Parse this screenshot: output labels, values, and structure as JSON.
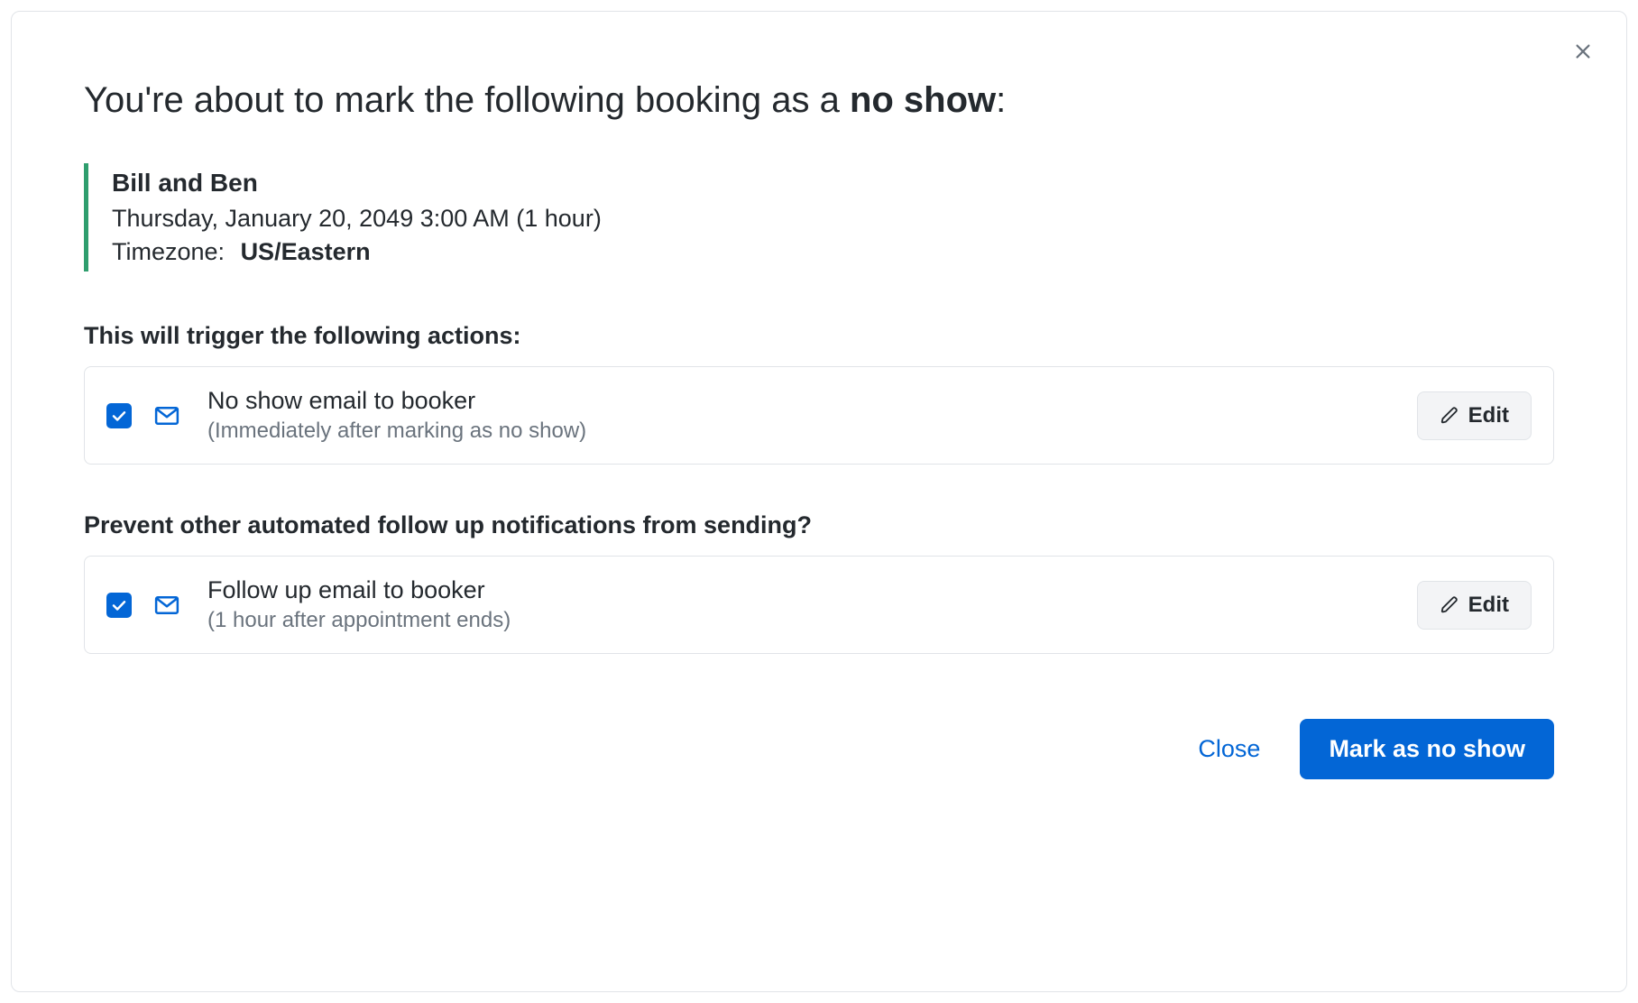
{
  "title": {
    "prefix": "You're about to mark the following booking as a ",
    "strong": "no show",
    "suffix": ":"
  },
  "booking": {
    "name": "Bill and Ben",
    "datetime": "Thursday, January 20, 2049 3:00 AM (1 hour)",
    "timezone_label": "Timezone:",
    "timezone_value": "US/Eastern"
  },
  "sections": {
    "trigger_title": "This will trigger the following actions:",
    "prevent_title": "Prevent other automated follow up notifications from sending?"
  },
  "actions": {
    "no_show": {
      "title": "No show email to booker",
      "subtitle": "(Immediately after marking as no show)",
      "edit_label": "Edit"
    },
    "follow_up": {
      "title": "Follow up email to booker",
      "subtitle": "(1 hour after appointment ends)",
      "edit_label": "Edit"
    }
  },
  "footer": {
    "close_label": "Close",
    "confirm_label": "Mark as no show"
  }
}
